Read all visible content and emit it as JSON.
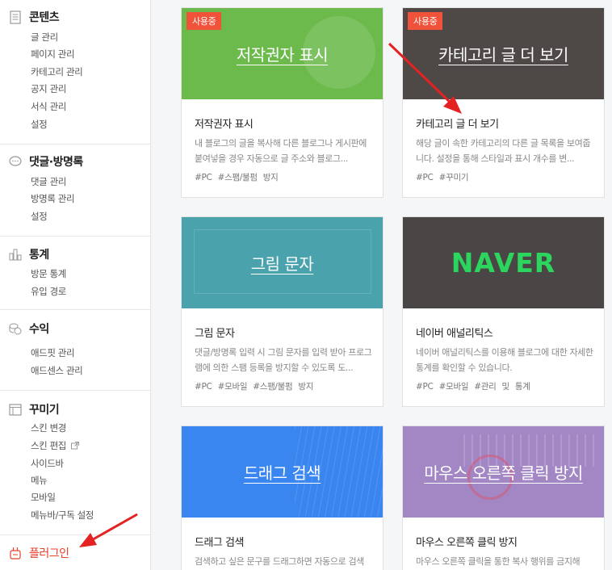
{
  "sidebar": {
    "content": {
      "title": "콘텐츠",
      "items": [
        "글 관리",
        "페이지 관리",
        "카테고리 관리",
        "공지 관리",
        "서식 관리",
        "설정"
      ]
    },
    "comments": {
      "title": "댓글·방명록",
      "items": [
        "댓글 관리",
        "방명록 관리",
        "설정"
      ]
    },
    "stats": {
      "title": "통계",
      "items": [
        "방문 통계",
        "유입 경로"
      ]
    },
    "revenue": {
      "title": "수익",
      "items": [
        "애드핏 관리",
        "애드센스 관리"
      ]
    },
    "decorate": {
      "title": "꾸미기",
      "items": [
        "스킨 변경",
        "스킨 편집",
        "사이드바",
        "메뉴",
        "모바일",
        "메뉴바/구독 설정"
      ]
    },
    "plugin": {
      "title": "플러그인"
    }
  },
  "cards": [
    {
      "thumb_title": "저작권자 표시",
      "badge": "사용중",
      "name": "저작권자 표시",
      "desc": "내 블로그의 글을 복사해 다른 블로그나 게시판에 붙여넣을 경우 자동으로 글 주소와 블로그...",
      "tags": "#PC  #스팸/불펌 방지",
      "color": "#6cba4c"
    },
    {
      "thumb_title": "카테고리 글 더 보기",
      "badge": "사용중",
      "name": "카테고리 글 더 보기",
      "desc": "해당 글이 속한 카테고리의 다른 글 목록을 보여줍니다. 설정을 통해 스타일과 표시 개수를 변...",
      "tags": "#PC  #꾸미기",
      "color": "#4e4847"
    },
    {
      "thumb_title": "그림 문자",
      "name": "그림 문자",
      "desc": "댓글/방명록 입력 시 그림 문자를 입력 받아 프로그램에 의한 스팸 등록을 방지할 수 있도록 도...",
      "tags": "#PC  #모바일  #스팸/불펌 방지",
      "color": "#4aa2ad"
    },
    {
      "thumb_title": "NAVER",
      "name": "네이버 애널리틱스",
      "desc": "네이버 애널리틱스를 이용해 블로그에 대한 자세한 통계를 확인할 수 있습니다.",
      "tags": "#PC  #모바일  #관리 및 통계",
      "color": "#4a4645"
    },
    {
      "thumb_title": "드래그 검색",
      "name": "드래그 검색",
      "desc": "검색하고 싶은 문구를 드래그하면 자동으로 검색",
      "tags": "",
      "color": "#3a86f0"
    },
    {
      "thumb_title": "마우스 오른쪽 클릭 방지",
      "name": "마우스 오른쪽 클릭 방지",
      "desc": "마우스 오른쪽 클릭을 통한 복사 행위를 금지해",
      "tags": "",
      "color": "#a287c4"
    }
  ],
  "colors": {
    "accent": "#e8402b",
    "badge": "#f0523a",
    "arrow": "#e52222"
  }
}
